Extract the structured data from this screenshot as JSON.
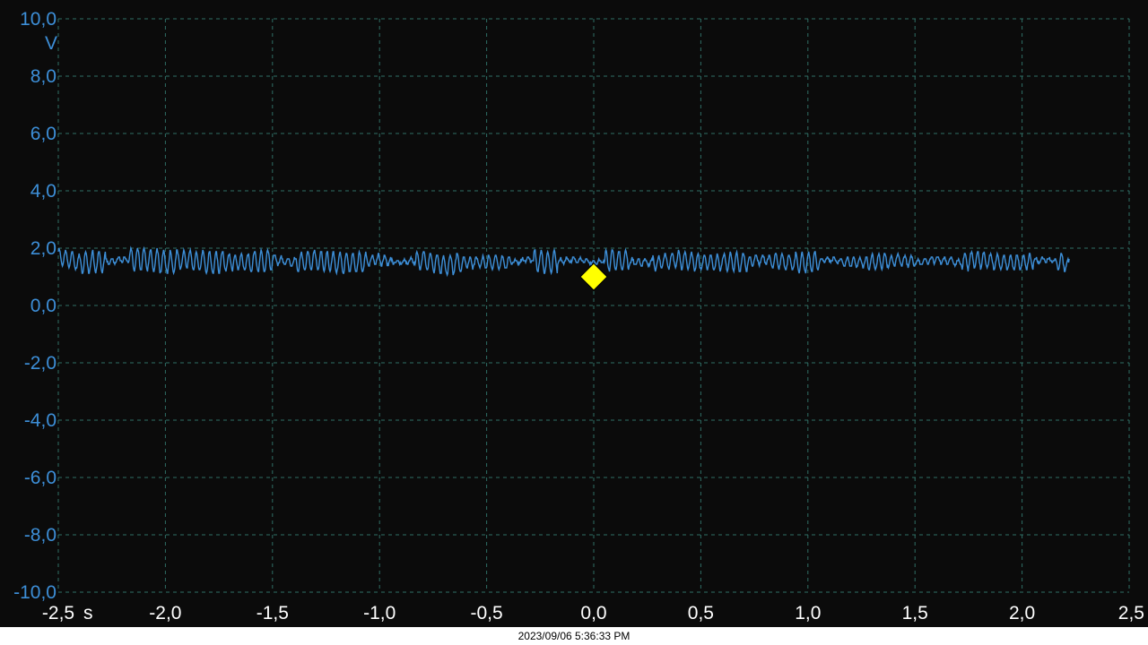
{
  "chart_data": {
    "type": "line",
    "title": "",
    "xlabel": "",
    "ylabel": "",
    "x_unit": "s",
    "y_unit": "V",
    "xlim": [
      -2.5,
      2.5
    ],
    "ylim": [
      -10,
      10
    ],
    "x_ticks": [
      -2.5,
      -2.0,
      -1.5,
      -1.0,
      -0.5,
      0.0,
      0.5,
      1.0,
      1.5,
      2.0,
      2.5
    ],
    "y_ticks": [
      -10,
      -8,
      -6,
      -4,
      -2,
      0,
      2,
      4,
      6,
      8,
      10
    ],
    "x_tick_labels": [
      "-2,5",
      "-2,0",
      "-1,5",
      "-1,0",
      "-0,5",
      "0,0",
      "0,5",
      "1,0",
      "1,5",
      "2,0",
      "2,5"
    ],
    "y_tick_labels": [
      "-10,0",
      "-8,0",
      "-6,0",
      "-4,0",
      "-2,0",
      "0,0",
      "2,0",
      "4,0",
      "6,0",
      "8,0",
      "10,0"
    ],
    "grid": true,
    "series": [
      {
        "color": "#3d8fd8",
        "x_range": [
          -2.5,
          2.22
        ],
        "baseline": 1.5,
        "amplitude_range": [
          -0.7,
          0.85
        ],
        "description_points": [
          [
            -2.5,
            1.7
          ],
          [
            -2.4,
            1.5
          ],
          [
            -2.3,
            1.5
          ],
          [
            -2.2,
            1.6
          ],
          [
            -2.1,
            1.6
          ],
          [
            -2.0,
            1.5
          ],
          [
            -1.9,
            1.6
          ],
          [
            -1.8,
            1.5
          ],
          [
            -1.7,
            1.5
          ],
          [
            -1.6,
            1.5
          ],
          [
            -1.5,
            1.6
          ],
          [
            -1.4,
            1.5
          ],
          [
            -1.3,
            1.6
          ],
          [
            -1.2,
            1.5
          ],
          [
            -1.1,
            1.5
          ],
          [
            -1.0,
            1.6
          ],
          [
            -0.9,
            1.5
          ],
          [
            -0.8,
            1.6
          ],
          [
            -0.7,
            1.4
          ],
          [
            -0.6,
            1.5
          ],
          [
            -0.5,
            1.5
          ],
          [
            -0.4,
            1.5
          ],
          [
            -0.3,
            1.6
          ],
          [
            -0.2,
            1.5
          ],
          [
            -0.1,
            1.6
          ],
          [
            0.0,
            1.5
          ],
          [
            0.1,
            1.6
          ],
          [
            0.2,
            1.5
          ],
          [
            0.3,
            1.5
          ],
          [
            0.4,
            1.6
          ],
          [
            0.5,
            1.5
          ],
          [
            0.6,
            1.5
          ],
          [
            0.7,
            1.5
          ],
          [
            0.8,
            1.6
          ],
          [
            0.9,
            1.5
          ],
          [
            1.0,
            1.5
          ],
          [
            1.1,
            1.6
          ],
          [
            1.2,
            1.5
          ],
          [
            1.3,
            1.5
          ],
          [
            1.4,
            1.6
          ],
          [
            1.5,
            1.5
          ],
          [
            1.6,
            1.6
          ],
          [
            1.7,
            1.5
          ],
          [
            1.8,
            1.6
          ],
          [
            1.9,
            1.5
          ],
          [
            2.0,
            1.5
          ],
          [
            2.1,
            1.6
          ],
          [
            2.2,
            1.5
          ],
          [
            2.22,
            1.25
          ]
        ]
      }
    ],
    "trigger_marker": {
      "x": 0.0,
      "y": 1.0,
      "color": "#ffff00",
      "shape": "diamond"
    }
  },
  "footer": {
    "timestamp": "2023/09/06 5:36:33 PM"
  }
}
